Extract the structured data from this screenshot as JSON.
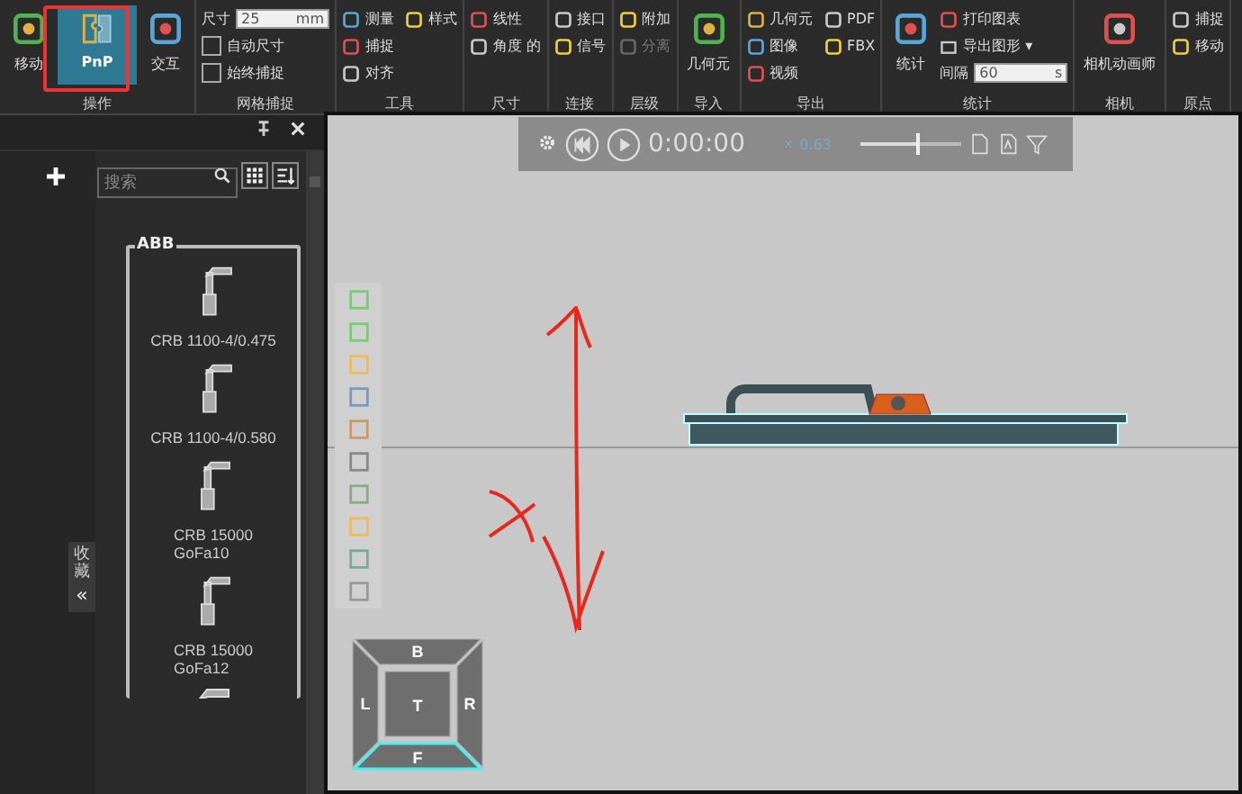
{
  "ribbon": {
    "groups": [
      {
        "label": "操作",
        "items": [
          {
            "kind": "big",
            "label": "移动",
            "selected": false
          },
          {
            "kind": "big",
            "label": "PnP",
            "selected": true
          },
          {
            "kind": "big",
            "label": "交互",
            "selected": false
          }
        ]
      },
      {
        "label": "网格捕捉",
        "items": [
          {
            "kind": "field",
            "label": "尺寸",
            "value": "25",
            "unit": "mm"
          },
          {
            "kind": "checkbox",
            "label": "自动尺寸",
            "checked": false
          },
          {
            "kind": "checkbox",
            "label": "始终捕捉",
            "checked": false
          }
        ]
      },
      {
        "label": "工具",
        "items": [
          {
            "kind": "small",
            "label": "测量",
            "disabled": false
          },
          {
            "kind": "small",
            "label": "捕捉",
            "disabled": false
          },
          {
            "kind": "small",
            "label": "对齐",
            "disabled": false
          },
          {
            "kind": "small",
            "label": "样式",
            "disabled": false
          }
        ]
      },
      {
        "label": "尺寸",
        "items": [
          {
            "kind": "small",
            "label": "线性",
            "disabled": false
          },
          {
            "kind": "small",
            "label": "角度 的",
            "disabled": false
          }
        ]
      },
      {
        "label": "连接",
        "items": [
          {
            "kind": "small",
            "label": "接口",
            "disabled": false
          },
          {
            "kind": "small",
            "label": "信号",
            "disabled": false
          }
        ]
      },
      {
        "label": "层级",
        "items": [
          {
            "kind": "small",
            "label": "附加",
            "disabled": false
          },
          {
            "kind": "small",
            "label": "分离",
            "disabled": true
          }
        ]
      },
      {
        "label": "导入",
        "items": [
          {
            "kind": "big",
            "label": "几何元",
            "selected": false
          }
        ]
      },
      {
        "label": "导出",
        "items": [
          {
            "kind": "small",
            "label": "几何元",
            "disabled": false
          },
          {
            "kind": "small",
            "label": "图像",
            "disabled": false
          },
          {
            "kind": "small",
            "label": "视频",
            "disabled": false
          },
          {
            "kind": "small",
            "label": "PDF",
            "disabled": false
          },
          {
            "kind": "small",
            "label": "FBX",
            "disabled": false
          }
        ]
      },
      {
        "label": "统计",
        "items": [
          {
            "kind": "big",
            "label": "统计",
            "selected": false
          },
          {
            "kind": "small",
            "label": "打印图表",
            "disabled": false
          },
          {
            "kind": "dropdown",
            "label": "导出图形",
            "caret": "▾"
          },
          {
            "kind": "field",
            "label": "间隔",
            "value": "60",
            "unit": "s"
          }
        ]
      },
      {
        "label": "相机",
        "items": [
          {
            "kind": "big",
            "label": "相机动画师",
            "selected": false
          }
        ]
      },
      {
        "label": "原点",
        "items": [
          {
            "kind": "small",
            "label": "捕捉",
            "disabled": false
          },
          {
            "kind": "small",
            "label": "移动",
            "disabled": false
          }
        ]
      }
    ]
  },
  "library": {
    "search": {
      "placeholder": "搜索"
    },
    "favorites_tab": {
      "label": "收藏",
      "collapse": "«"
    },
    "group": {
      "title": "ABB",
      "items": [
        {
          "lines": [
            "CRB 1100-4/0.475"
          ]
        },
        {
          "lines": [
            "CRB 1100-4/0.580"
          ]
        },
        {
          "lines": [
            "CRB 15000",
            "GoFa10"
          ]
        },
        {
          "lines": [
            "CRB 15000",
            "GoFa12"
          ]
        }
      ]
    }
  },
  "viewport": {
    "playback": {
      "time": "0:00:00",
      "speed_prefix": "x",
      "speed": "0.63",
      "level": 0.55
    },
    "view_cube": [
      {
        "label": "B",
        "selected": false
      },
      {
        "label": "L",
        "selected": false
      },
      {
        "label": "T",
        "selected": false
      },
      {
        "label": "R",
        "selected": false
      },
      {
        "label": "F",
        "selected": true
      }
    ]
  }
}
